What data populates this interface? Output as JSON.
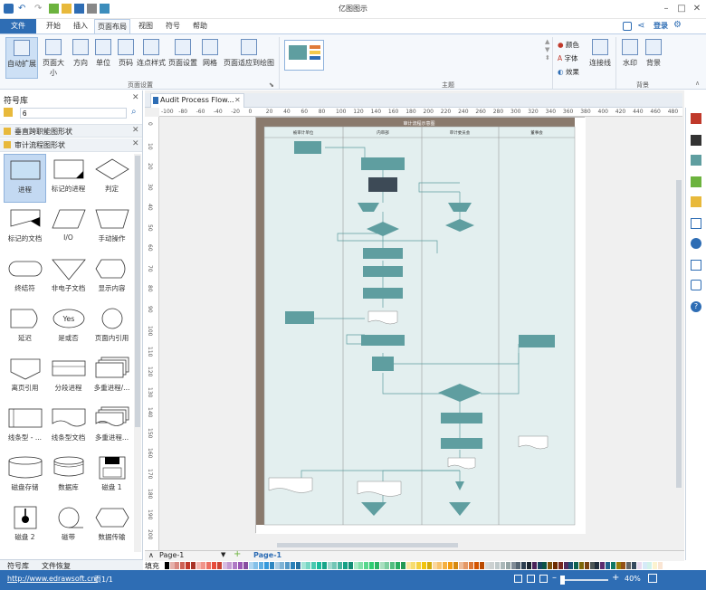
{
  "app": {
    "title": "亿图图示"
  },
  "menu": {
    "file": "文件",
    "items": [
      "开始",
      "插入",
      "页面布局",
      "视图",
      "符号",
      "帮助"
    ],
    "login": "登录"
  },
  "ribbon": {
    "buttons": [
      {
        "label": "自动扩展",
        "icon": "auto-expand-icon"
      },
      {
        "label": "页面大小",
        "icon": "page-size-icon"
      },
      {
        "label": "方向",
        "icon": "orientation-icon"
      },
      {
        "label": "单位",
        "icon": "units-icon"
      },
      {
        "label": "页码",
        "icon": "page-number-icon"
      },
      {
        "label": "连点样式",
        "icon": "jump-style-icon"
      },
      {
        "label": "页面设置",
        "icon": "page-setup-icon"
      },
      {
        "label": "网格",
        "icon": "grid-icon"
      },
      {
        "label": "页面适应到绘图",
        "icon": "fit-page-icon"
      }
    ],
    "groups": {
      "page_setup": "页面设置",
      "theme": "主题",
      "background": "背景"
    },
    "theme_options": [
      {
        "label": "颜色",
        "icon": "color-icon"
      },
      {
        "label": "字体",
        "icon": "font-icon"
      },
      {
        "label": "效果",
        "icon": "effect-icon"
      }
    ],
    "connector": "连接线",
    "watermark": "水印",
    "background": "背景"
  },
  "library": {
    "title": "符号库",
    "search_value": "6",
    "categories": [
      "垂直跨职能图形状",
      "审计流程图形状"
    ],
    "shapes": [
      "进程",
      "标记的进程",
      "判定",
      "标记的文档",
      "I/O",
      "手动操作",
      "终结符",
      "非电子文档",
      "显示内容",
      "延迟",
      "是或否",
      "页面内引用",
      "离页引用",
      "分段进程",
      "多重进程/...",
      "线条型 - ...",
      "线条型文档",
      "多重进程...",
      "磁盘存储",
      "数据库",
      "磁盘 1",
      "磁盘 2",
      "磁带",
      "数据传输"
    ],
    "yes_text": "Yes",
    "bottom_tabs": [
      "符号库",
      "文件恢复"
    ]
  },
  "document": {
    "tab": "Audit Process Flow...",
    "diagram_title": "审计流程示意图",
    "lanes": [
      "被审计单位",
      "内审部",
      "审计委员会",
      "董事会"
    ]
  },
  "ruler": {
    "h": [
      "-100",
      "-80",
      "-60",
      "-40",
      "-20",
      "0",
      "20",
      "40",
      "60",
      "80",
      "100",
      "120",
      "140",
      "160",
      "180",
      "200",
      "220",
      "240",
      "260",
      "280",
      "300",
      "320",
      "340",
      "360",
      "380",
      "400",
      "420",
      "440",
      "460",
      "480"
    ],
    "v": [
      "0",
      "10",
      "20",
      "30",
      "40",
      "50",
      "60",
      "70",
      "80",
      "90",
      "100",
      "110",
      "120",
      "130",
      "140",
      "150",
      "160",
      "170",
      "180",
      "190",
      "200"
    ]
  },
  "pages": {
    "current": "Page-1",
    "active": "Page-1"
  },
  "palette_label": "填充",
  "status": {
    "url": "http://www.edrawsoft.cn/",
    "page": "页1/1",
    "zoom": "40%"
  },
  "colors": {
    "accent": "#2e6db4",
    "shape": "#5f9ea0",
    "lane": "#e3efef",
    "border": "#8a7a6d"
  }
}
